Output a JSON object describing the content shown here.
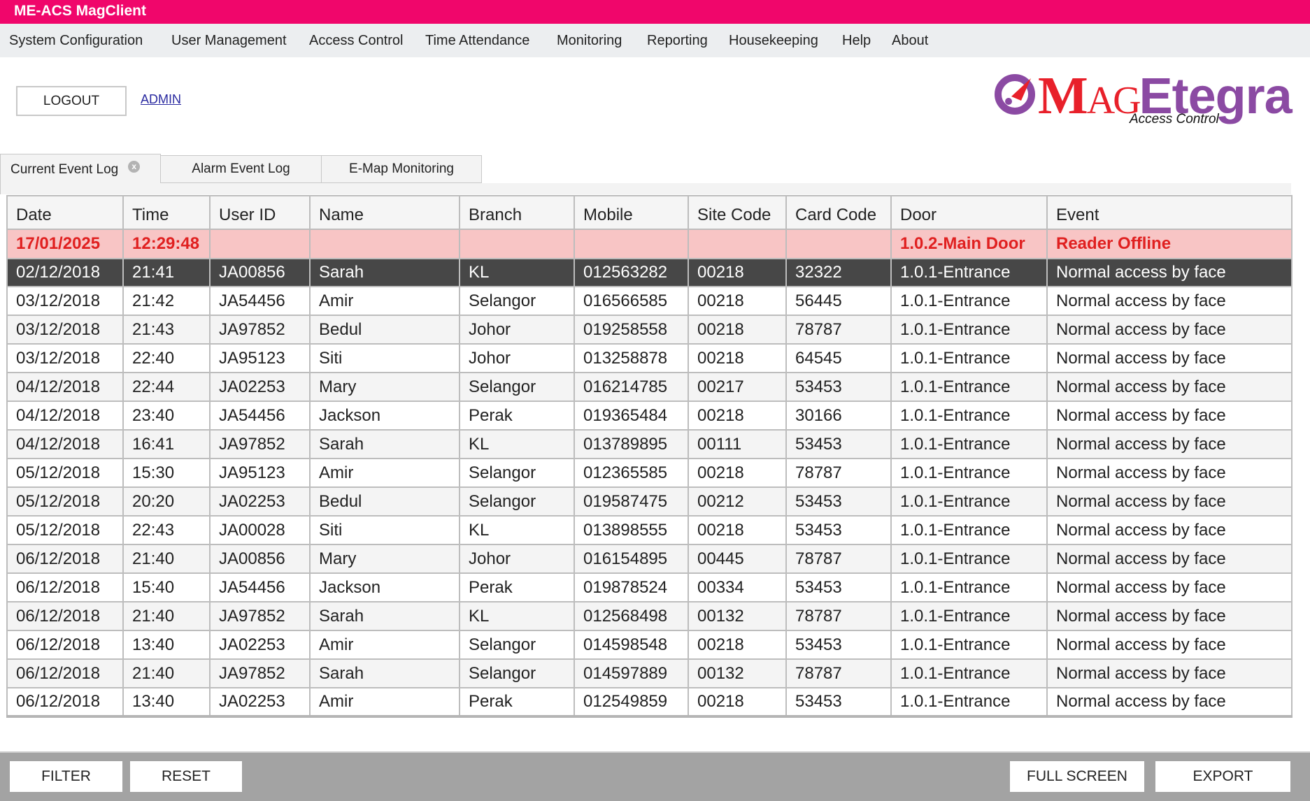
{
  "app": {
    "title": "ME-ACS MagClient"
  },
  "menu": [
    "System Configuration",
    "User Management",
    "Access Control",
    "Time Attendance",
    "Monitoring",
    "Reporting",
    "Housekeeping",
    "Help",
    "About"
  ],
  "session": {
    "logout_label": "LOGOUT",
    "user_link": "ADMIN"
  },
  "logo": {
    "m": "M",
    "ag": "AG",
    "etegra": "Etegra",
    "subtitle": "Access Control",
    "mark_icon": "logo-gauge-icon"
  },
  "tabs": [
    {
      "label": "Current Event Log",
      "active": true,
      "closable": true,
      "close_glyph": "x"
    },
    {
      "label": "Alarm Event Log",
      "active": false
    },
    {
      "label": "E-Map Monitoring",
      "active": false
    }
  ],
  "table": {
    "columns": [
      "Date",
      "Time",
      "User ID",
      "Name",
      "Branch",
      "Mobile",
      "Site Code",
      "Card Code",
      "Door",
      "Event"
    ],
    "alarm_row": {
      "date": "17/01/2025",
      "time": "12:29:48",
      "user_id": "",
      "name": "",
      "branch": "",
      "mobile": "",
      "site_code": "",
      "card_code": "",
      "door": "1.0.2-Main Door",
      "event": "Reader Offline"
    },
    "rows": [
      [
        "02/12/2018",
        "21:41",
        "JA00856",
        "Sarah",
        "KL",
        "012563282",
        "00218",
        "32322",
        "1.0.1-Entrance",
        "Normal access by face"
      ],
      [
        "03/12/2018",
        "21:42",
        "JA54456",
        "Amir",
        "Selangor",
        "016566585",
        "00218",
        "56445",
        "1.0.1-Entrance",
        "Normal access by face"
      ],
      [
        "03/12/2018",
        "21:43",
        "JA97852",
        "Bedul",
        "Johor",
        "019258558",
        "00218",
        "78787",
        "1.0.1-Entrance",
        "Normal access by face"
      ],
      [
        "03/12/2018",
        "22:40",
        "JA95123",
        "Siti",
        "Johor",
        "013258878",
        "00218",
        "64545",
        "1.0.1-Entrance",
        "Normal access by face"
      ],
      [
        "04/12/2018",
        "22:44",
        "JA02253",
        "Mary",
        "Selangor",
        "016214785",
        "00217",
        "53453",
        "1.0.1-Entrance",
        "Normal access by face"
      ],
      [
        "04/12/2018",
        "23:40",
        "JA54456",
        "Jackson",
        "Perak",
        "019365484",
        "00218",
        "30166",
        "1.0.1-Entrance",
        "Normal access by face"
      ],
      [
        "04/12/2018",
        "16:41",
        "JA97852",
        "Sarah",
        "KL",
        "013789895",
        "00111",
        "53453",
        "1.0.1-Entrance",
        "Normal access by face"
      ],
      [
        "05/12/2018",
        "15:30",
        "JA95123",
        "Amir",
        "Selangor",
        "012365585",
        "00218",
        "78787",
        "1.0.1-Entrance",
        "Normal access by face"
      ],
      [
        "05/12/2018",
        "20:20",
        "JA02253",
        "Bedul",
        "Selangor",
        "019587475",
        "00212",
        "53453",
        "1.0.1-Entrance",
        "Normal access by face"
      ],
      [
        "05/12/2018",
        "22:43",
        "JA00028",
        "Siti",
        "KL",
        "013898555",
        "00218",
        "53453",
        "1.0.1-Entrance",
        "Normal access by face"
      ],
      [
        "06/12/2018",
        "21:40",
        "JA00856",
        "Mary",
        "Johor",
        "016154895",
        "00445",
        "78787",
        "1.0.1-Entrance",
        "Normal access by face"
      ],
      [
        "06/12/2018",
        "15:40",
        "JA54456",
        "Jackson",
        "Perak",
        "019878524",
        "00334",
        "53453",
        "1.0.1-Entrance",
        "Normal access by face"
      ],
      [
        "06/12/2018",
        "21:40",
        "JA97852",
        "Sarah",
        "KL",
        "012568498",
        "00132",
        "78787",
        "1.0.1-Entrance",
        "Normal access by face"
      ],
      [
        "06/12/2018",
        "13:40",
        "JA02253",
        "Amir",
        "Selangor",
        "014598548",
        "00218",
        "53453",
        "1.0.1-Entrance",
        "Normal access by face"
      ],
      [
        "06/12/2018",
        "21:40",
        "JA97852",
        "Sarah",
        "Selangor",
        "014597889",
        "00132",
        "78787",
        "1.0.1-Entrance",
        "Normal access by face"
      ],
      [
        "06/12/2018",
        "13:40",
        "JA02253",
        "Amir",
        "Perak",
        "012549859",
        "00218",
        "53453",
        "1.0.1-Entrance",
        "Normal access by face"
      ]
    ],
    "selected_row_index": 0
  },
  "footer": {
    "filter_label": "FILTER",
    "reset_label": "RESET",
    "fullscreen_label": "FULL SCREEN",
    "export_label": "EXPORT"
  },
  "colors": {
    "brand": "#f0066b",
    "alarm_bg": "#f8c5c5",
    "alarm_text": "#e02020",
    "selected_bg": "#474747",
    "logo_red": "#e8202a",
    "logo_purple": "#8b4aa3"
  }
}
